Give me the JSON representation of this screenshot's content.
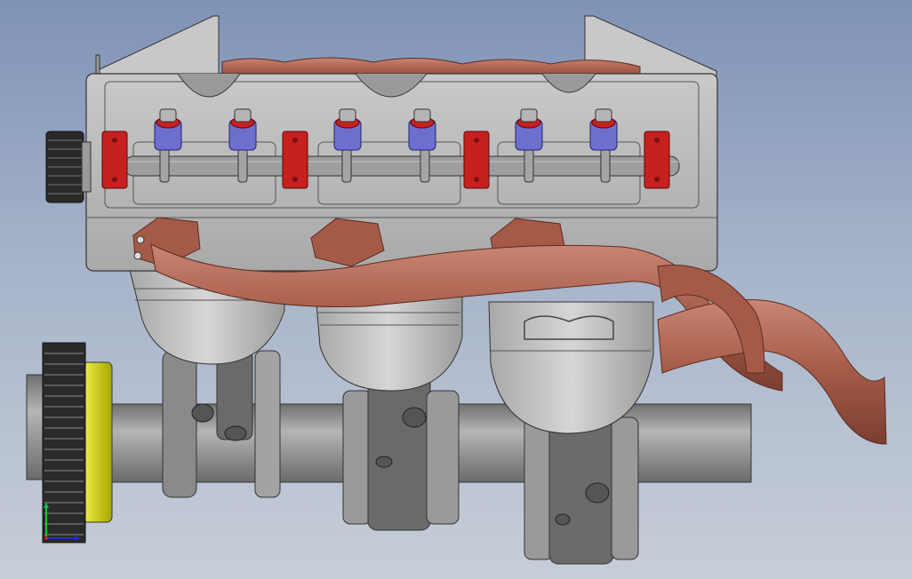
{
  "viewport": {
    "background_top": "#7f93b7",
    "background_bottom": "#c7ced9"
  },
  "model": {
    "cylinder_count": 3,
    "valve_count": 6,
    "colors": {
      "head": "#b8b8b8",
      "head_dark": "#8c8c8c",
      "exhaust": "#a05846",
      "exhaust_light": "#c07a66",
      "cam_bearing": "#c8201e",
      "valve_spring": "#6d6fcf",
      "pulley": "#d0d000",
      "crankshaft": "#9a9a9a",
      "piston": "#c2c2c2",
      "rod": "#7c7c7c"
    }
  },
  "triad": {
    "x_color": "#1e2bd4",
    "y_color": "#18c43a",
    "z_color": "#cc1f1f"
  }
}
